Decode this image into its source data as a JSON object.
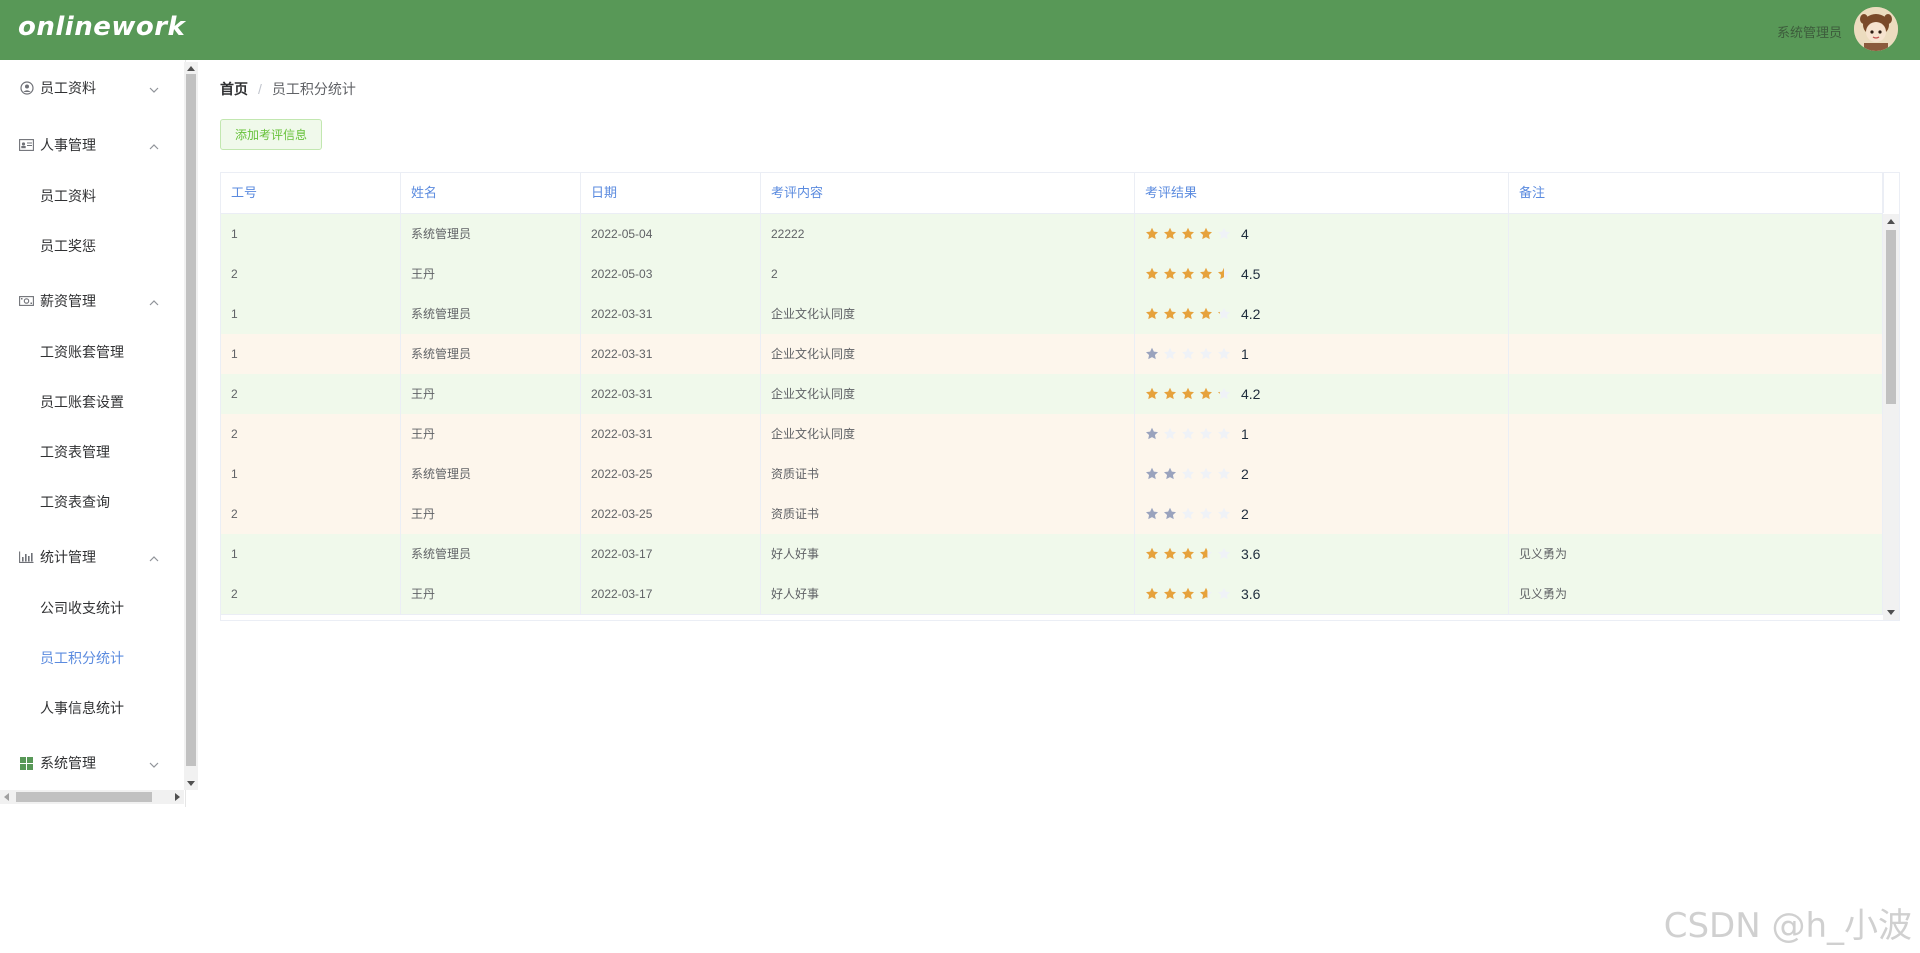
{
  "header": {
    "logo": "onlinework",
    "user_name": "系统管理员",
    "bg_color": "#589857"
  },
  "sidebar": {
    "groups": [
      {
        "label": "员工资料",
        "icon": "user-circle-icon",
        "expanded": false,
        "items": []
      },
      {
        "label": "人事管理",
        "icon": "id-card-icon",
        "expanded": true,
        "items": [
          {
            "label": "员工资料"
          },
          {
            "label": "员工奖惩"
          }
        ]
      },
      {
        "label": "薪资管理",
        "icon": "money-icon",
        "expanded": true,
        "items": [
          {
            "label": "工资账套管理"
          },
          {
            "label": "员工账套设置"
          },
          {
            "label": "工资表管理"
          },
          {
            "label": "工资表查询"
          }
        ]
      },
      {
        "label": "统计管理",
        "icon": "bar-chart-icon",
        "expanded": true,
        "items": [
          {
            "label": "公司收支统计"
          },
          {
            "label": "员工积分统计",
            "active": true
          },
          {
            "label": "人事信息统计"
          }
        ]
      },
      {
        "label": "系统管理",
        "icon": "windows-icon",
        "expanded": false,
        "items": []
      }
    ]
  },
  "breadcrumb": {
    "home": "首页",
    "separator": "/",
    "current": "员工积分统计"
  },
  "toolbar": {
    "add_label": "添加考评信息"
  },
  "table": {
    "columns": [
      "工号",
      "姓名",
      "日期",
      "考评内容",
      "考评结果",
      "备注"
    ],
    "rows": [
      {
        "id": "1",
        "name": "系统管理员",
        "date": "2022-05-04",
        "content": "22222",
        "score": "4",
        "score_value": 4,
        "remark": "",
        "tint": "green"
      },
      {
        "id": "2",
        "name": "王丹",
        "date": "2022-05-03",
        "content": "2",
        "score": "4.5",
        "score_value": 4.5,
        "remark": "",
        "tint": "green"
      },
      {
        "id": "1",
        "name": "系统管理员",
        "date": "2022-03-31",
        "content": "企业文化认同度",
        "score": "4.2",
        "score_value": 4.2,
        "remark": "",
        "tint": "green"
      },
      {
        "id": "1",
        "name": "系统管理员",
        "date": "2022-03-31",
        "content": "企业文化认同度",
        "score": "1",
        "score_value": 1,
        "remark": "",
        "tint": "cream"
      },
      {
        "id": "2",
        "name": "王丹",
        "date": "2022-03-31",
        "content": "企业文化认同度",
        "score": "4.2",
        "score_value": 4.2,
        "remark": "",
        "tint": "green"
      },
      {
        "id": "2",
        "name": "王丹",
        "date": "2022-03-31",
        "content": "企业文化认同度",
        "score": "1",
        "score_value": 1,
        "remark": "",
        "tint": "cream"
      },
      {
        "id": "1",
        "name": "系统管理员",
        "date": "2022-03-25",
        "content": "资质证书",
        "score": "2",
        "score_value": 2,
        "remark": "",
        "tint": "cream"
      },
      {
        "id": "2",
        "name": "王丹",
        "date": "2022-03-25",
        "content": "资质证书",
        "score": "2",
        "score_value": 2,
        "remark": "",
        "tint": "cream"
      },
      {
        "id": "1",
        "name": "系统管理员",
        "date": "2022-03-17",
        "content": "好人好事",
        "score": "3.6",
        "score_value": 3.6,
        "remark": "见义勇为",
        "tint": "green"
      },
      {
        "id": "2",
        "name": "王丹",
        "date": "2022-03-17",
        "content": "好人好事",
        "score": "3.6",
        "score_value": 3.6,
        "remark": "见义勇为",
        "tint": "green"
      }
    ]
  },
  "colors": {
    "star_high": "#e6a23c",
    "star_low": "#9aa3bd",
    "star_empty": "#eff2f7",
    "link_blue": "#5b8bdf",
    "btn_green": "#67c23a"
  },
  "watermark": "CSDN @h_小波"
}
